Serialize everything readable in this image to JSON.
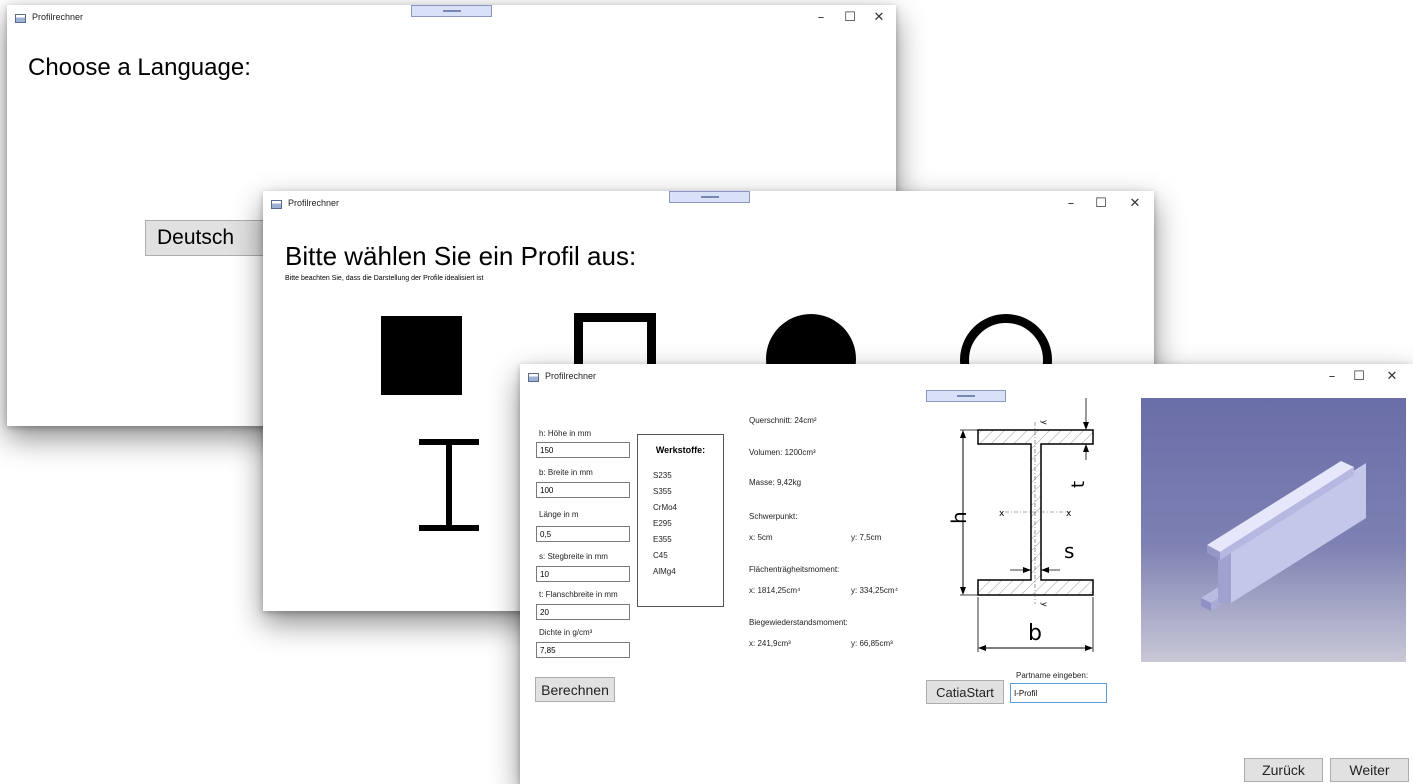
{
  "language_window": {
    "title": "Profilrechner",
    "controls": {
      "minimize": "–",
      "maximize": "☐",
      "close": "✕"
    },
    "heading": "Choose a Language:",
    "button_label": "Deutsch"
  },
  "profile_window": {
    "title": "Profilrechner",
    "controls": {
      "minimize": "–",
      "maximize": "☐",
      "close": "✕"
    },
    "heading": "Bitte wählen Sie ein Profil aus:",
    "note": "Bitte beachten Sie, dass die Darstellung der Profile idealisiert ist",
    "profile_icons": [
      "square-profile-icon",
      "rectangular-tube-icon",
      "round-bar-icon",
      "round-tube-icon",
      "i-beam-icon"
    ]
  },
  "calculator_window": {
    "title": "Profilrechner",
    "controls": {
      "minimize": "–",
      "maximize": "☐",
      "close": "✕"
    },
    "inputs": {
      "h_label": "h: Höhe in mm",
      "h_value": "150",
      "b_label": "b: Breite in mm",
      "b_value": "100",
      "length_label": "Länge in m",
      "length_value": "0,5",
      "s_label": "s: Stegbreite in mm",
      "s_value": "10",
      "t_label": "t: Flanschbreite in mm",
      "t_value": "20",
      "density_label": "Dichte in g/cm³",
      "density_value": "7,85"
    },
    "materials": {
      "title": "Werkstoffe:",
      "items": [
        "S235",
        "S355",
        "CrMo4",
        "E295",
        "E355",
        "C45",
        "AlMg4"
      ]
    },
    "results": {
      "cross_section": "Querschnitt: 24cm²",
      "volume": "Volumen: 1200cm³",
      "mass": "Masse: 9,42kg",
      "centroid_label": "Schwerpunkt:",
      "centroid_x": "x: 5cm",
      "centroid_y": "y: 7,5cm",
      "inertia_label": "Flächenträgheitsmoment:",
      "inertia_x": "x: 1814,25cm⁴",
      "inertia_y": "y: 334,25cm⁴",
      "modulus_label": "Biegewiederstandsmoment:",
      "modulus_x": "x: 241,9cm³",
      "modulus_y": "y: 66,85cm³"
    },
    "diagram_labels": {
      "h": "h",
      "b": "b",
      "s": "s",
      "t": "t",
      "x_left": "x",
      "x_right": "x",
      "y_top": "y",
      "y_bottom": "y"
    },
    "calculate_button": "Berechnen",
    "catia_button": "CatiaStart",
    "partname_label": "Partname eingeben:",
    "partname_value": "I-Profil",
    "back_button": "Zurück",
    "next_button": "Weiter",
    "colors": {
      "render_top": "#6a6ea8",
      "render_bottom": "#c8c8d6",
      "beam": "#cfd0ee"
    }
  }
}
